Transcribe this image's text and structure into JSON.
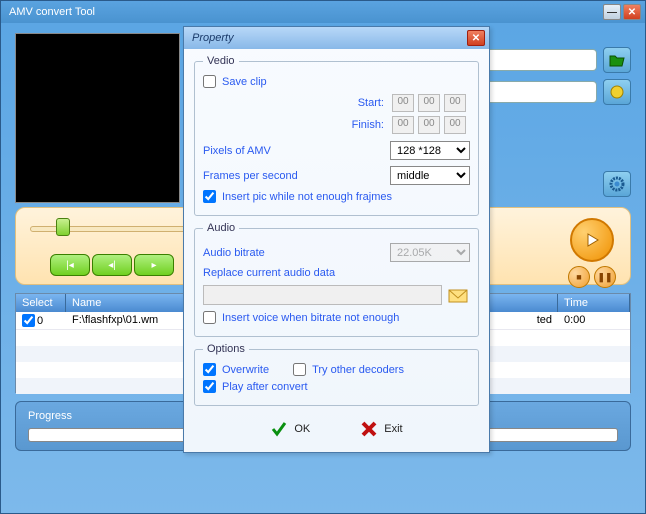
{
  "main": {
    "title": "AMV convert Tool"
  },
  "playback": {},
  "table": {
    "headers": {
      "select": "Select",
      "name": "Name",
      "status": "",
      "time": "Time"
    },
    "rows": [
      {
        "index": "0",
        "checked": true,
        "name": "F:\\flashfxp\\01.wm",
        "status_suffix": "ted",
        "time": "0:00"
      }
    ]
  },
  "progress": {
    "label": "Progress"
  },
  "dialog": {
    "title": "Property",
    "video": {
      "legend": "Vedio",
      "save_clip": "Save clip",
      "start_label": "Start:",
      "finish_label": "Finish:",
      "start": [
        "00",
        "00",
        "00"
      ],
      "finish": [
        "00",
        "00",
        "00"
      ],
      "pixels_label": "Pixels of AMV",
      "pixels_value": "128 *128",
      "fps_label": "Frames per second",
      "fps_value": "middle",
      "insert_pic": "Insert pic while not enough frajmes"
    },
    "audio": {
      "legend": "Audio",
      "bitrate_label": "Audio bitrate",
      "bitrate_value": "22.05K",
      "replace_label": "Replace current audio data",
      "insert_voice": "Insert voice when bitrate not enough"
    },
    "options": {
      "legend": "Options",
      "overwrite": "Overwrite",
      "try_decoders": "Try other decoders",
      "play_after": "Play after convert"
    },
    "buttons": {
      "ok": "OK",
      "exit": "Exit"
    }
  }
}
